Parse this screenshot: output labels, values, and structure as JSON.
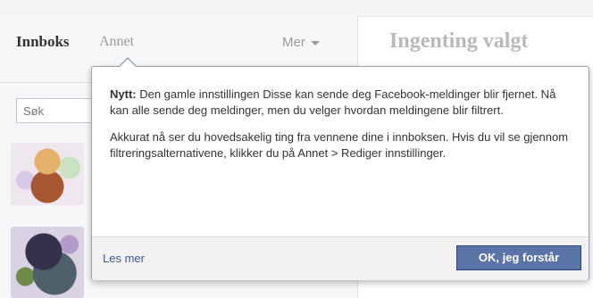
{
  "header": {
    "inbox_tab": "Innboks",
    "other_tab": "Annet",
    "more_label": "Mer",
    "right_title": "Ingenting valgt"
  },
  "search": {
    "placeholder": "Søk"
  },
  "popover": {
    "new_label": "Nytt:",
    "paragraph1_rest": " Den gamle innstillingen Disse kan sende deg Facebook-meldinger blir fjernet. Nå kan alle sende deg meldinger, men du velger hvordan meldingene blir filtrert.",
    "paragraph2": "Akkurat nå ser du hovedsakelig ting fra vennene dine i innboksen. Hvis du vil se gjennom filtreringsalternativene, klikker du på Annet > Rediger innstillinger.",
    "learn_more": "Les mer",
    "ok_button": "OK, jeg forstår"
  },
  "colors": {
    "link": "#3b5998",
    "button_bg": "#5b74a8"
  }
}
